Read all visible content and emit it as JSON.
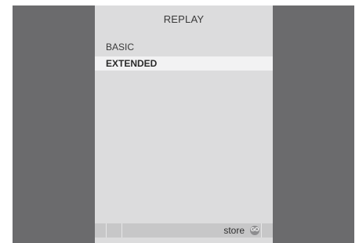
{
  "header": {
    "title": "REPLAY"
  },
  "menu": {
    "items": [
      {
        "label": "BASIC",
        "selected": false
      },
      {
        "label": "EXTENDED",
        "selected": true
      }
    ]
  },
  "footer": {
    "action_label": "store",
    "go_button_label": "GO"
  },
  "colors": {
    "background_frame": "#6b6b6d",
    "panel": "#dcdcdd",
    "selected_row": "#f2f2f3",
    "footer_bar": "#c7c7c8",
    "go_button": "#8d8d8f"
  }
}
